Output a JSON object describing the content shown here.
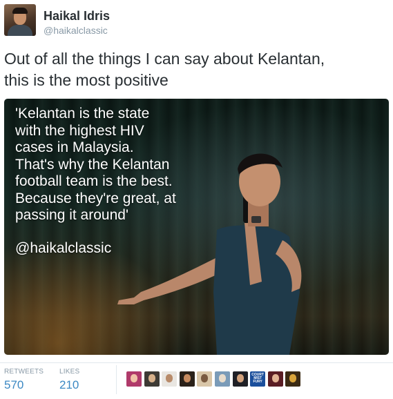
{
  "user": {
    "name": "Haikal Idris",
    "handle": "@haikalclassic"
  },
  "tweet": {
    "text": "Out of all the things I can say about Kelantan,\nthis is the most positive"
  },
  "photo": {
    "caption": "'Kelantan is the state\nwith the highest HIV\ncases in Malaysia.\nThat's why the Kelantan\nfootball team is the best.\nBecause they're great, at\npassing it around'",
    "watermark": "@haikalclassic"
  },
  "stats": {
    "retweets_label": "RETWEETS",
    "retweets_count": "570",
    "likes_label": "LIKES",
    "likes_count": "210"
  },
  "likers": [
    {
      "icon": "liker-avatar",
      "bg": "#b03a6a",
      "fg": "#f1c3a8"
    },
    {
      "icon": "liker-avatar",
      "bg": "#3d3a34",
      "fg": "#d6b08a"
    },
    {
      "icon": "liker-avatar",
      "bg": "#e9e6e1",
      "fg": "#b88b6a"
    },
    {
      "icon": "liker-avatar",
      "bg": "#2a2119",
      "fg": "#c58a5f"
    },
    {
      "icon": "liker-avatar",
      "bg": "#d9c6a8",
      "fg": "#7a5a40"
    },
    {
      "icon": "liker-avatar",
      "bg": "#7a9bb8",
      "fg": "#e8dccc"
    },
    {
      "icon": "liker-avatar",
      "bg": "#1f2026",
      "fg": "#d2a17c"
    },
    {
      "icon": "liker-avatar-court-fury",
      "bg": "#1b4f9c",
      "fg": "#ffffff",
      "text": "COURT\nMIST\nFURY"
    },
    {
      "icon": "liker-avatar",
      "bg": "#5a1d24",
      "fg": "#e2b394"
    },
    {
      "icon": "liker-avatar",
      "bg": "#3b2a14",
      "fg": "#d9a43a"
    }
  ]
}
